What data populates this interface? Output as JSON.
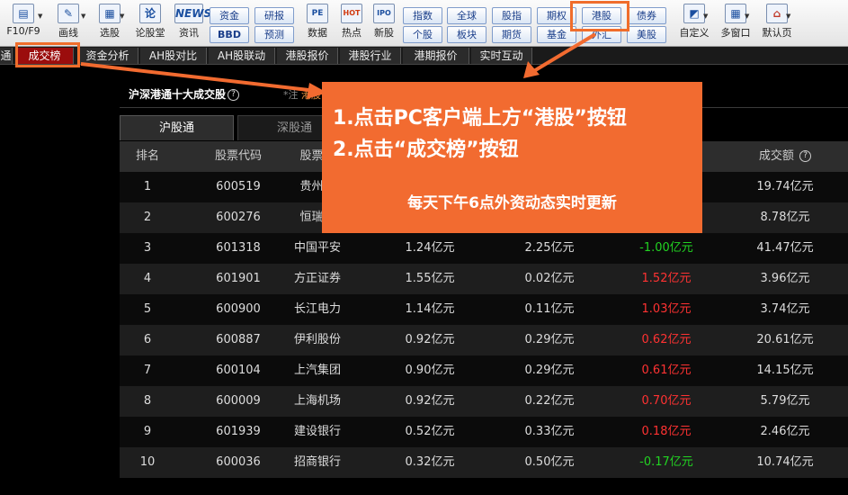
{
  "toolbar": {
    "left_items": [
      {
        "icon": "window-icon",
        "label": "F10/F9"
      },
      {
        "icon": "pencil-icon",
        "label": "画线"
      },
      {
        "icon": "stock-pick-icon",
        "label": "选股"
      },
      {
        "icon": "lun-icon",
        "glyph": "论",
        "label": "论股堂"
      },
      {
        "icon": "news-icon",
        "glyph": "NEWS",
        "label": "资讯"
      }
    ],
    "mid_buttons": [
      "资金",
      "研报",
      "BBD",
      "预测"
    ],
    "right_items": [
      {
        "icon": "pe-icon",
        "glyph": "PE",
        "label": "数据"
      },
      {
        "icon": "hot-icon",
        "glyph": "HOT",
        "label": "热点"
      },
      {
        "icon": "ipo-icon",
        "glyph": "IPO",
        "label": "新股"
      }
    ],
    "market_buttons": [
      [
        "指数",
        "全球",
        "股指",
        "期权",
        "港股",
        "债券"
      ],
      [
        "个股",
        "板块",
        "期货",
        "基金",
        "外汇",
        "美股"
      ]
    ],
    "end_items": [
      {
        "icon": "customize-icon",
        "label": "自定义"
      },
      {
        "icon": "multi-window-icon",
        "label": "多窗口"
      },
      {
        "icon": "home-icon",
        "label": "默认页"
      }
    ]
  },
  "tabs": [
    "通",
    "成交榜",
    "资金分析",
    "AH股对比",
    "AH股联动",
    "港股报价",
    "港股行业",
    "港期报价",
    "实时互动"
  ],
  "section_title": "沪深港通十大成交股",
  "note": {
    "prefix": "*注",
    "link": "港股"
  },
  "subtabs": [
    "沪股通",
    "深股通"
  ],
  "table": {
    "headers": [
      "排名",
      "股票代码",
      "股票名",
      "",
      "",
      "",
      "成交额"
    ],
    "rows": [
      {
        "rank": "1",
        "code": "600519",
        "name": "贵州茅",
        "buy": "",
        "sell": "",
        "net": "",
        "net_sign": "neu",
        "turnover": "19.74亿元"
      },
      {
        "rank": "2",
        "code": "600276",
        "name": "恒瑞医",
        "buy": "",
        "sell": "",
        "net": "",
        "net_sign": "neu",
        "turnover": "8.78亿元"
      },
      {
        "rank": "3",
        "code": "601318",
        "name": "中国平安",
        "buy": "1.24亿元",
        "sell": "2.25亿元",
        "net": "-1.00亿元",
        "net_sign": "neg",
        "turnover": "41.47亿元"
      },
      {
        "rank": "4",
        "code": "601901",
        "name": "方正证券",
        "buy": "1.55亿元",
        "sell": "0.02亿元",
        "net": "1.52亿元",
        "net_sign": "pos",
        "turnover": "3.96亿元"
      },
      {
        "rank": "5",
        "code": "600900",
        "name": "长江电力",
        "buy": "1.14亿元",
        "sell": "0.11亿元",
        "net": "1.03亿元",
        "net_sign": "pos",
        "turnover": "3.74亿元"
      },
      {
        "rank": "6",
        "code": "600887",
        "name": "伊利股份",
        "buy": "0.92亿元",
        "sell": "0.29亿元",
        "net": "0.62亿元",
        "net_sign": "pos",
        "turnover": "20.61亿元"
      },
      {
        "rank": "7",
        "code": "600104",
        "name": "上汽集团",
        "buy": "0.90亿元",
        "sell": "0.29亿元",
        "net": "0.61亿元",
        "net_sign": "pos",
        "turnover": "14.15亿元"
      },
      {
        "rank": "8",
        "code": "600009",
        "name": "上海机场",
        "buy": "0.92亿元",
        "sell": "0.22亿元",
        "net": "0.70亿元",
        "net_sign": "pos",
        "turnover": "5.79亿元"
      },
      {
        "rank": "9",
        "code": "601939",
        "name": "建设银行",
        "buy": "0.52亿元",
        "sell": "0.33亿元",
        "net": "0.18亿元",
        "net_sign": "pos",
        "turnover": "2.46亿元"
      },
      {
        "rank": "10",
        "code": "600036",
        "name": "招商银行",
        "buy": "0.32亿元",
        "sell": "0.50亿元",
        "net": "-0.17亿元",
        "net_sign": "neg",
        "turnover": "10.74亿元"
      }
    ]
  },
  "callout": {
    "line1": "1.点击PC客户端上方“港股”按钮",
    "line2": "2.点击“成交榜”按钮",
    "line3": "每天下午6点外资动态实时更新"
  },
  "colors": {
    "accent": "#f26b30",
    "up": "#ff3232",
    "down": "#22d322",
    "active_tab": "#9b0d0d"
  }
}
